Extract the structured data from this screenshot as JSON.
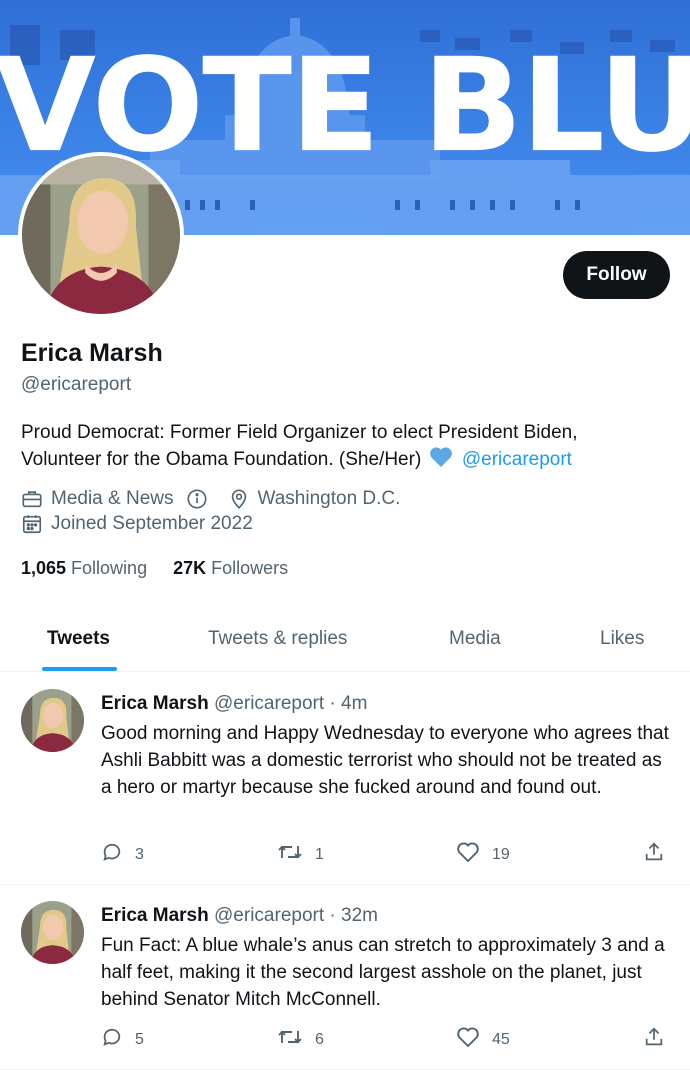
{
  "banner": {
    "text": "VOTE BLUE"
  },
  "profile": {
    "name": "Erica Marsh",
    "handle": "@ericareport",
    "follow_label": "Follow",
    "bio_text": "Proud Democrat: Former Field Organizer to elect President Biden, Volunteer for the Obama Foundation. (She/Her)",
    "bio_mention": "@ericareport",
    "category": "Media & News",
    "location": "Washington D.C.",
    "joined": "Joined September 2022",
    "following_count": "1,065",
    "following_label": "Following",
    "followers_count": "27K",
    "followers_label": "Followers"
  },
  "tabs": [
    {
      "label": "Tweets",
      "active": true
    },
    {
      "label": "Tweets & replies",
      "active": false
    },
    {
      "label": "Media",
      "active": false
    },
    {
      "label": "Likes",
      "active": false
    }
  ],
  "tweets": [
    {
      "name": "Erica Marsh",
      "handle": "@ericareport",
      "time": "· 4m",
      "text": "Good morning and Happy Wednesday to everyone who agrees that Ashli Babbitt was a domestic terrorist who should not be treated as a hero or martyr because she fucked around and found out.",
      "replies": "3",
      "retweets": "1",
      "likes": "19"
    },
    {
      "name": "Erica Marsh",
      "handle": "@ericareport",
      "time": "· 32m",
      "text": "Fun Fact: A blue whale’s anus can stretch to approximately 3 and a half feet, making it the second largest asshole on the planet, just behind Senator Mitch McConnell.",
      "replies": "5",
      "retweets": "6",
      "likes": "45"
    }
  ],
  "colors": {
    "accent": "#1d9bf0",
    "text": "#0f1419",
    "muted": "#536471",
    "banner": "#3b82e6",
    "heart": "#5aa9e6"
  },
  "icons": [
    "briefcase-icon",
    "info-icon",
    "location-pin-icon",
    "calendar-icon",
    "reply-icon",
    "retweet-icon",
    "like-icon",
    "share-icon",
    "blue-heart-icon"
  ]
}
